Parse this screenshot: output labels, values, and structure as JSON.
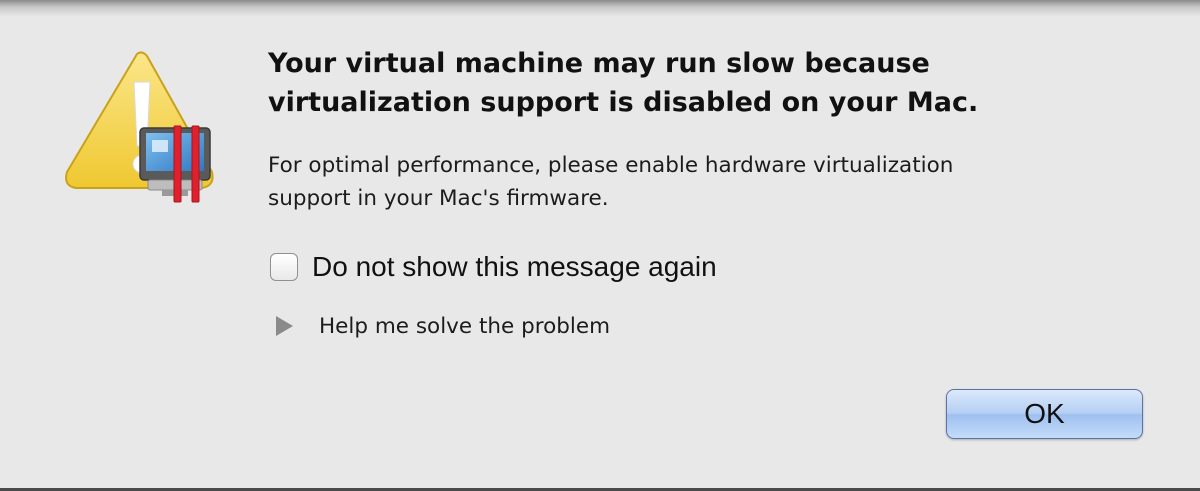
{
  "dialog": {
    "title": "Your virtual machine may run slow because\nvirtualization support is disabled on your Mac.",
    "message": "For optimal performance, please enable hardware virtualization\nsupport in your Mac's firmware.",
    "checkbox": {
      "label": "Do not show this message again",
      "checked": false
    },
    "disclosure": {
      "label": "Help me solve the problem",
      "expanded": false
    },
    "ok_button_label": "OK",
    "icon": "warning-vm-icon"
  },
  "colors": {
    "warning_yellow": "#f3d443",
    "pause_red": "#e0202c",
    "ok_button_blue": "#b5cff3",
    "background": "#e8e8e8"
  }
}
